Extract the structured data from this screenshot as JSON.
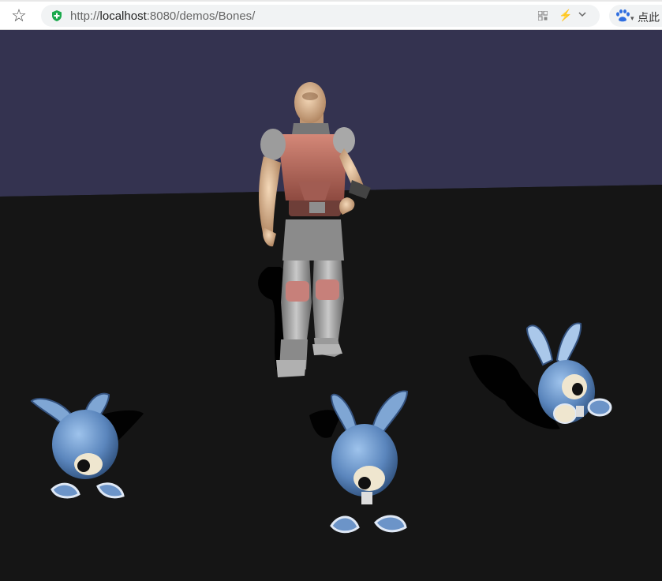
{
  "browser": {
    "url_prefix": "http://",
    "url_host": "localhost",
    "url_rest": ":8080/demos/Bones/",
    "search_placeholder": "点此"
  },
  "scene": {
    "sky_color": "#343350",
    "ground_color": "#151515",
    "character": "armored-soldier",
    "bunny_count": 3
  }
}
